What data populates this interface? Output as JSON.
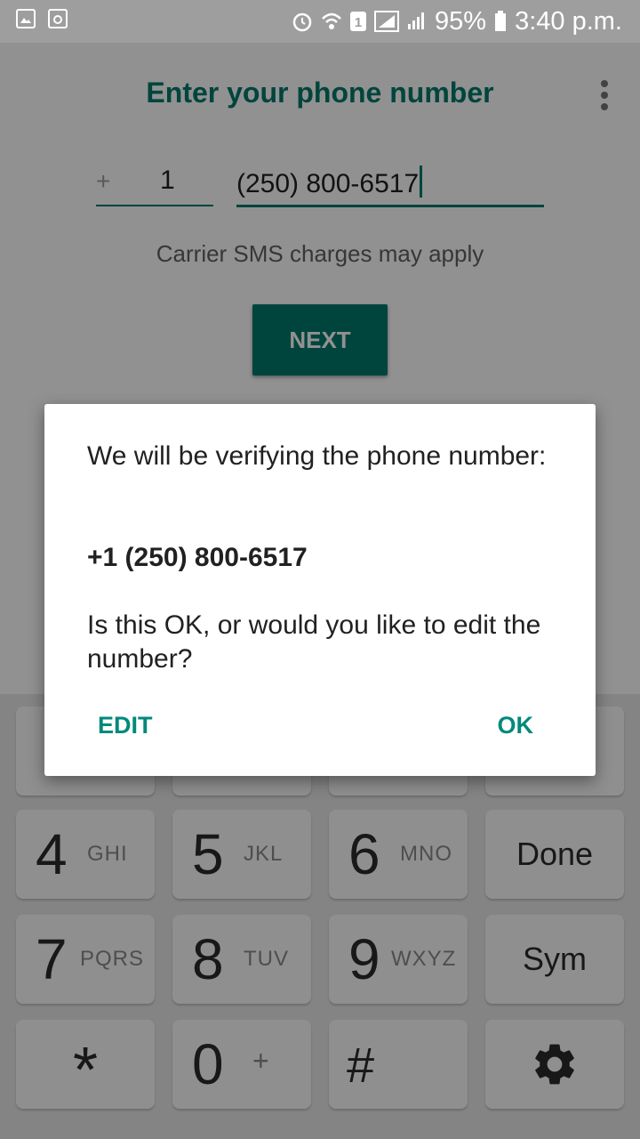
{
  "status_bar": {
    "left_icons": [
      "image-icon",
      "recycle-icon"
    ],
    "right_icons": [
      "alarm-icon",
      "wifi-icon",
      "sim-1-icon",
      "signal-icon",
      "signal-icon",
      "battery-icon"
    ],
    "battery": "95%",
    "time": "3:40 p.m."
  },
  "screen": {
    "title": "Enter your phone number",
    "country_code_prefix": "+",
    "country_code": "1",
    "phone_number": "(250) 800-6517",
    "sms_notice": "Carrier SMS charges may apply",
    "next_label": "NEXT"
  },
  "dialog": {
    "message": "We will be verifying the phone number:",
    "number": "+1 (250) 800-6517",
    "question": "Is this OK, or would you like to edit the number?",
    "edit_label": "EDIT",
    "ok_label": "OK"
  },
  "keyboard": {
    "keys": [
      {
        "num": "4",
        "letters": "GHI"
      },
      {
        "num": "5",
        "letters": "JKL"
      },
      {
        "num": "6",
        "letters": "MNO"
      },
      {
        "label": "Done"
      },
      {
        "num": "7",
        "letters": "PQRS"
      },
      {
        "num": "8",
        "letters": "TUV"
      },
      {
        "num": "9",
        "letters": "WXYZ"
      },
      {
        "label": "Sym"
      },
      {
        "symbol": "*"
      },
      {
        "num": "0",
        "letters": "+"
      },
      {
        "symbol": "#"
      },
      {
        "icon": "gear-icon"
      }
    ]
  },
  "colors": {
    "accent": "#00796b",
    "dialog_button": "#00897b"
  }
}
